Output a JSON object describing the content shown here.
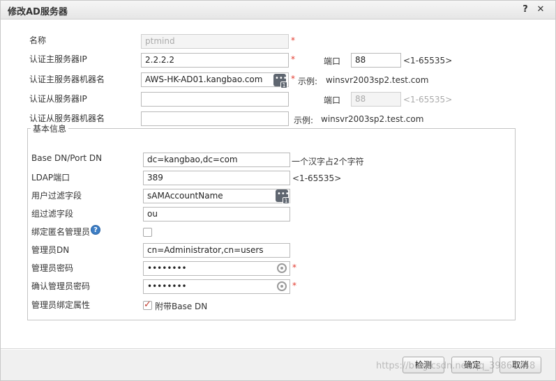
{
  "dialog": {
    "title": "修改AD服务器",
    "help_label": "?",
    "close_label": "✕"
  },
  "form": {
    "name": {
      "label": "名称",
      "value": "ptmind",
      "required": "*"
    },
    "primary_ip": {
      "label": "认证主服务器IP",
      "value": "2.2.2.2",
      "required": "*"
    },
    "port": {
      "label": "端口",
      "value": "88",
      "hint": "<1-65535>"
    },
    "primary_host": {
      "label": "认证主服务器机器名",
      "value": "AWS-HK-AD01.kangbao.com",
      "required": "*",
      "example_label": "示例:",
      "example_value": "winsvr2003sp2.test.com"
    },
    "secondary_ip": {
      "label": "认证从服务器IP",
      "value": ""
    },
    "secondary_port": {
      "label": "端口",
      "value": "88",
      "hint": "<1-65535>"
    },
    "secondary_host": {
      "label": "认证从服务器机器名",
      "value": "",
      "example_label": "示例:",
      "example_value": "winsvr2003sp2.test.com"
    }
  },
  "basic": {
    "legend": "基本信息",
    "base_dn": {
      "label": "Base DN/Port DN",
      "value": "dc=kangbao,dc=com",
      "hint": "一个汉字占2个字符"
    },
    "ldap_port": {
      "label": "LDAP端口",
      "value": "389",
      "hint": "<1-65535>"
    },
    "user_filter": {
      "label": "用户过滤字段",
      "value": "sAMAccountName"
    },
    "group_filter": {
      "label": "组过滤字段",
      "value": "ou"
    },
    "anon_admin": {
      "label": "绑定匿名管理员",
      "help": "?",
      "checked": false
    },
    "admin_dn": {
      "label": "管理员DN",
      "value": "cn=Administrator,cn=users"
    },
    "admin_pwd": {
      "label": "管理员密码",
      "value": "••••••••",
      "required": "*"
    },
    "confirm_pwd": {
      "label": "确认管理员密码",
      "value": "••••••••",
      "required": "*"
    },
    "bind_attr": {
      "label": "管理员绑定属性",
      "option_label": "附带Base DN",
      "checked": true
    }
  },
  "footer": {
    "detect_label": "检测",
    "ok_label": "确定",
    "cancel_label": "取消",
    "watermark": "https://blog.csdn.net/qq_39867748"
  },
  "icons": {
    "select_icon": "list-select-icon",
    "eye_icon": "show-password-icon",
    "help_icon": "help-circle-icon"
  },
  "colors": {
    "required": "#e23a2e",
    "help": "#3d7ec5",
    "check": "#c0392b"
  }
}
